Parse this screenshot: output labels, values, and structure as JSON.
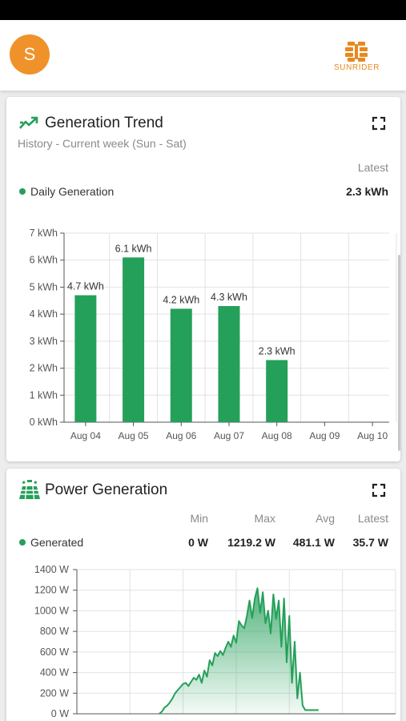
{
  "header": {
    "avatar_initial": "S",
    "brand_name": "SUNRIDER",
    "brand_color": "#e8891f",
    "avatar_color": "#f0922a"
  },
  "generation_trend": {
    "title": "Generation Trend",
    "subtitle": "History - Current week (Sun - Sat)",
    "latest_header": "Latest",
    "legend_label": "Daily Generation",
    "latest_value": "2.3 kWh",
    "icon": "trending-up-icon",
    "expand_icon": "fullscreen-icon"
  },
  "power_generation": {
    "title": "Power Generation",
    "headers": {
      "min": "Min",
      "max": "Max",
      "avg": "Avg",
      "latest": "Latest"
    },
    "legend_label": "Generated",
    "values": {
      "min": "0 W",
      "max": "1219.2 W",
      "avg": "481.1 W",
      "latest": "35.7 W"
    },
    "icon": "solar-panel-icon",
    "expand_icon": "fullscreen-icon"
  },
  "chart_data": [
    {
      "type": "bar",
      "categories": [
        "Aug 04",
        "Aug 05",
        "Aug 06",
        "Aug 07",
        "Aug 08",
        "Aug 09",
        "Aug 10"
      ],
      "series": [
        {
          "name": "Daily Generation",
          "values": [
            4.7,
            6.1,
            4.2,
            4.3,
            2.3,
            null,
            null
          ]
        }
      ],
      "data_labels": [
        "4.7 kWh",
        "6.1 kWh",
        "4.2 kWh",
        "4.3 kWh",
        "2.3 kWh"
      ],
      "ylim": [
        0,
        7
      ],
      "yticks": [
        "0 kWh",
        "1 kWh",
        "2 kWh",
        "3 kWh",
        "4 kWh",
        "5 kWh",
        "6 kWh",
        "7 kWh"
      ],
      "grid": true,
      "color": "#25a05a"
    },
    {
      "type": "area",
      "series": [
        {
          "name": "Generated",
          "x": [
            6.2,
            6.4,
            6.6,
            6.8,
            7.0,
            7.2,
            7.4,
            7.6,
            7.8,
            8.0,
            8.2,
            8.4,
            8.6,
            8.8,
            9.0,
            9.2,
            9.4,
            9.6,
            9.8,
            10.0,
            10.2,
            10.4,
            10.6,
            10.8,
            11.0,
            11.2,
            11.4,
            11.6,
            11.8,
            12.0,
            12.2,
            12.4,
            12.6,
            12.8,
            13.0,
            13.2,
            13.4,
            13.6,
            13.8,
            14.0,
            14.2,
            14.4,
            14.6,
            14.8,
            15.0,
            15.2,
            15.4,
            15.6,
            15.8,
            16.0,
            16.2,
            16.4,
            16.6,
            16.8,
            17.0,
            17.2,
            17.4,
            17.6,
            17.8,
            18.0,
            18.2
          ],
          "values": [
            0,
            20,
            60,
            80,
            110,
            150,
            200,
            230,
            260,
            290,
            300,
            270,
            310,
            350,
            330,
            380,
            300,
            420,
            360,
            520,
            470,
            590,
            560,
            610,
            570,
            640,
            700,
            650,
            760,
            690,
            900,
            860,
            830,
            950,
            1100,
            930,
            1120,
            1219.2,
            980,
            1180,
            880,
            1000,
            780,
            1160,
            920,
            1100,
            650,
            1120,
            500,
            950,
            300,
            700,
            150,
            400,
            80,
            35.7,
            35.7,
            35.7,
            35.7,
            35.7,
            35.7
          ]
        }
      ],
      "ylim": [
        0,
        1400
      ],
      "yticks": [
        "0 W",
        "200 W",
        "400 W",
        "600 W",
        "800 W",
        "1000 W",
        "1200 W",
        "1400 W"
      ],
      "xlim": [
        0,
        24
      ],
      "grid": true,
      "color": "#25a05a"
    }
  ]
}
